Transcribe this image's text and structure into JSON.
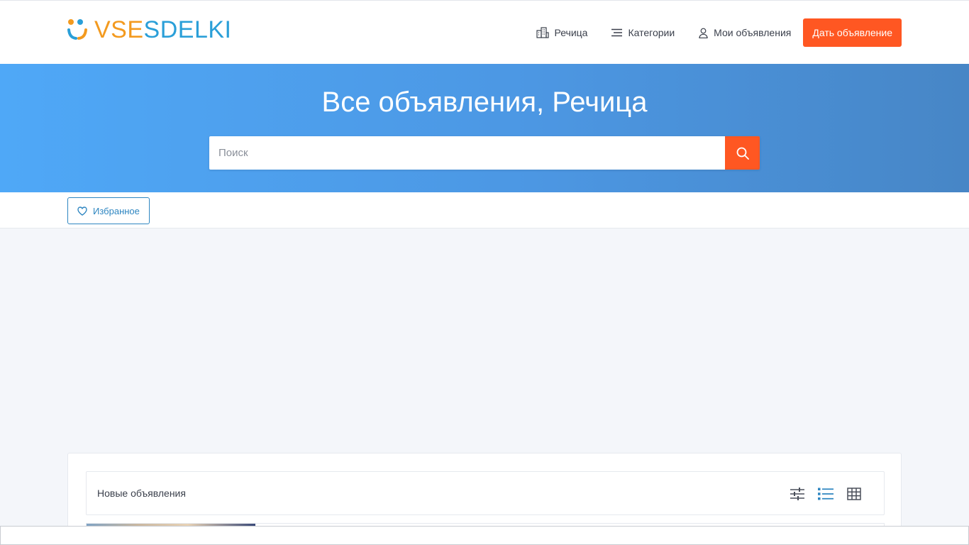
{
  "header": {
    "logo": {
      "part1": "VSE",
      "part2": "SDELKI"
    },
    "nav": [
      {
        "label": "Речица",
        "icon": "city-icon"
      },
      {
        "label": "Категории",
        "icon": "menu-icon"
      },
      {
        "label": "Мои объявления",
        "icon": "user-icon"
      }
    ],
    "post_button": "Дать объявление"
  },
  "hero": {
    "title": "Все объявления, Речица",
    "search_placeholder": "Поиск",
    "search_icon": "search-icon"
  },
  "subbar": {
    "favorites_label": "Избранное",
    "favorites_icon": "heart-icon"
  },
  "listings": {
    "title": "Новые объявления",
    "view_modes": [
      "filters-icon",
      "list-view-icon",
      "grid-view-icon"
    ],
    "active_view": "list-view-icon"
  },
  "colors": {
    "accent": "#ff5722",
    "link": "#2e86c1",
    "hero_start": "#4fa8f7",
    "hero_end": "#4786c6",
    "logo_orange": "#f39a1f",
    "logo_blue": "#2a9fd8"
  }
}
